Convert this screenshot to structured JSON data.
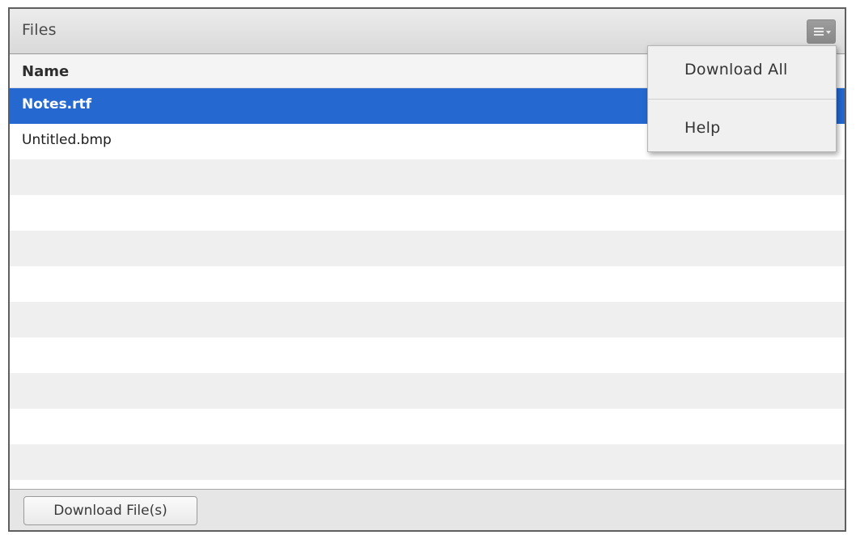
{
  "panel": {
    "title": "Files",
    "menu_icon": "menu-icon"
  },
  "list": {
    "header": "Name",
    "rows": [
      {
        "name": "Notes.rtf",
        "selected": true
      },
      {
        "name": "Untitled.bmp",
        "selected": false
      }
    ]
  },
  "menu": {
    "items": [
      "Download All",
      "Help"
    ]
  },
  "footer": {
    "download_label": "Download File(s)"
  },
  "colors": {
    "selection": "#2468d0",
    "row_alt": "#efefef"
  }
}
